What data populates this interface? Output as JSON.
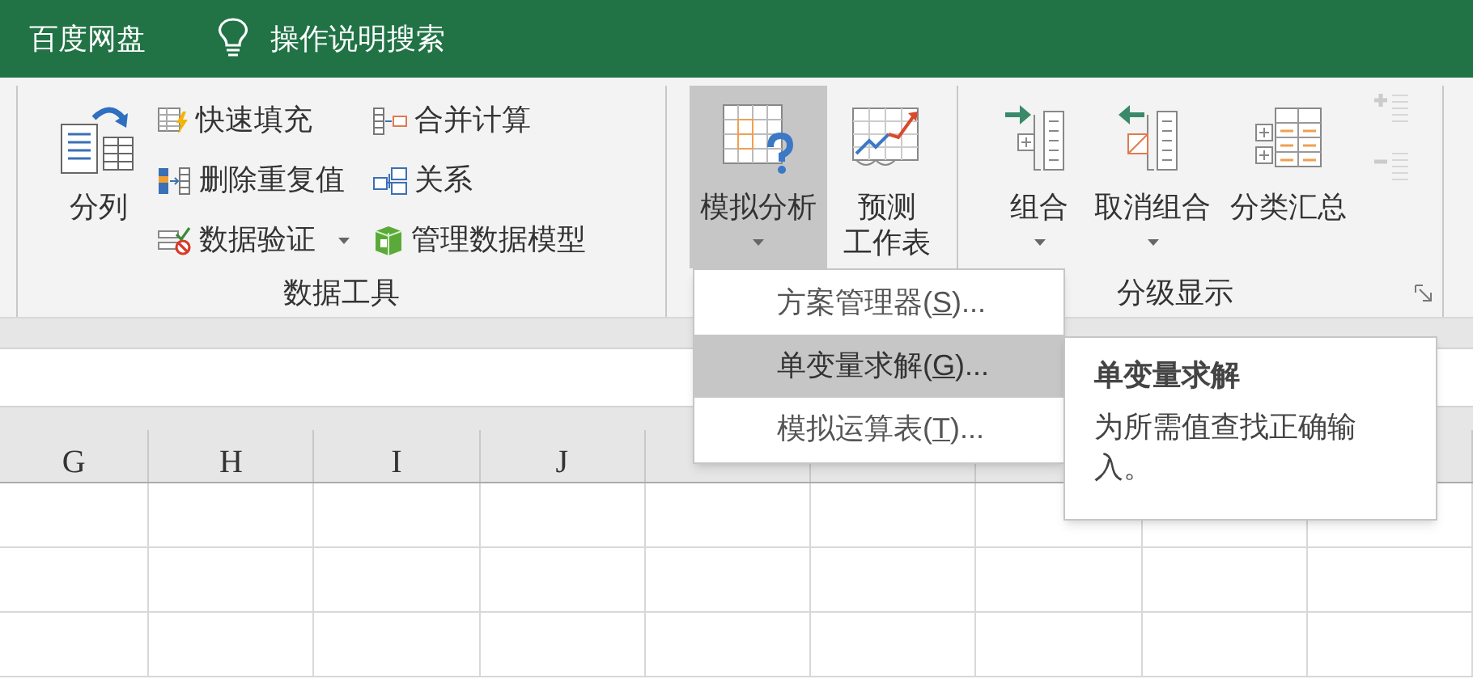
{
  "title_bar": {
    "app_label": "百度网盘",
    "search_label": "操作说明搜索"
  },
  "ribbon": {
    "groups": [
      {
        "label": "数据工具",
        "buttons": [
          {
            "lines": [
              "分列"
            ],
            "dropdown": false,
            "pressed": false
          }
        ],
        "small_buttons": [
          {
            "label": "快速填充",
            "dropdown": false
          },
          {
            "label": "删除重复值",
            "dropdown": false
          },
          {
            "label": "数据验证",
            "dropdown": true
          },
          {
            "label": "合并计算",
            "dropdown": false
          },
          {
            "label": "关系",
            "dropdown": false
          },
          {
            "label": "管理数据模型",
            "dropdown": false
          }
        ]
      },
      {
        "buttons": [
          {
            "lines": [
              "模拟分析"
            ],
            "dropdown": true,
            "pressed": true
          },
          {
            "lines": [
              "预测",
              "工作表"
            ],
            "dropdown": false,
            "pressed": false
          }
        ]
      },
      {
        "label": "分级显示",
        "dialog_launcher": true,
        "buttons": [
          {
            "lines": [
              "组合"
            ],
            "dropdown": true,
            "pressed": false
          },
          {
            "lines": [
              "取消组合"
            ],
            "dropdown": true,
            "pressed": false
          },
          {
            "lines": [
              "分类汇总"
            ],
            "dropdown": false,
            "pressed": false
          }
        ],
        "detail_buttons": [
          {
            "disabled": true
          },
          {
            "disabled": true
          }
        ]
      }
    ]
  },
  "menu": {
    "items": [
      {
        "before": "方案管理器(",
        "accelerator": "S",
        "after": ")...",
        "selected": false
      },
      {
        "before": "单变量求解(",
        "accelerator": "G",
        "after": ")...",
        "selected": true
      },
      {
        "before": "模拟运算表(",
        "accelerator": "T",
        "after": ")...",
        "selected": false
      }
    ]
  },
  "tooltip": {
    "title": "单变量求解",
    "description": "为所需值查找正确输入。"
  },
  "sheet": {
    "columns": [
      "G",
      "H",
      "I",
      "J"
    ]
  }
}
